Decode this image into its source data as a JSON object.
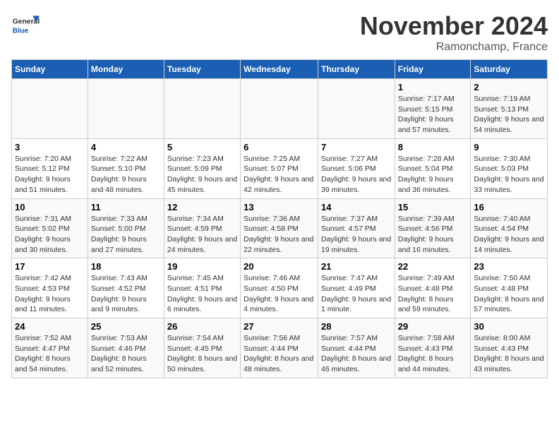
{
  "logo": {
    "text_general": "General",
    "text_blue": "Blue"
  },
  "header": {
    "month": "November 2024",
    "location": "Ramonchamp, France"
  },
  "days_of_week": [
    "Sunday",
    "Monday",
    "Tuesday",
    "Wednesday",
    "Thursday",
    "Friday",
    "Saturday"
  ],
  "weeks": [
    [
      {
        "day": "",
        "info": ""
      },
      {
        "day": "",
        "info": ""
      },
      {
        "day": "",
        "info": ""
      },
      {
        "day": "",
        "info": ""
      },
      {
        "day": "",
        "info": ""
      },
      {
        "day": "1",
        "info": "Sunrise: 7:17 AM\nSunset: 5:15 PM\nDaylight: 9 hours and 57 minutes."
      },
      {
        "day": "2",
        "info": "Sunrise: 7:19 AM\nSunset: 5:13 PM\nDaylight: 9 hours and 54 minutes."
      }
    ],
    [
      {
        "day": "3",
        "info": "Sunrise: 7:20 AM\nSunset: 5:12 PM\nDaylight: 9 hours and 51 minutes."
      },
      {
        "day": "4",
        "info": "Sunrise: 7:22 AM\nSunset: 5:10 PM\nDaylight: 9 hours and 48 minutes."
      },
      {
        "day": "5",
        "info": "Sunrise: 7:23 AM\nSunset: 5:09 PM\nDaylight: 9 hours and 45 minutes."
      },
      {
        "day": "6",
        "info": "Sunrise: 7:25 AM\nSunset: 5:07 PM\nDaylight: 9 hours and 42 minutes."
      },
      {
        "day": "7",
        "info": "Sunrise: 7:27 AM\nSunset: 5:06 PM\nDaylight: 9 hours and 39 minutes."
      },
      {
        "day": "8",
        "info": "Sunrise: 7:28 AM\nSunset: 5:04 PM\nDaylight: 9 hours and 36 minutes."
      },
      {
        "day": "9",
        "info": "Sunrise: 7:30 AM\nSunset: 5:03 PM\nDaylight: 9 hours and 33 minutes."
      }
    ],
    [
      {
        "day": "10",
        "info": "Sunrise: 7:31 AM\nSunset: 5:02 PM\nDaylight: 9 hours and 30 minutes."
      },
      {
        "day": "11",
        "info": "Sunrise: 7:33 AM\nSunset: 5:00 PM\nDaylight: 9 hours and 27 minutes."
      },
      {
        "day": "12",
        "info": "Sunrise: 7:34 AM\nSunset: 4:59 PM\nDaylight: 9 hours and 24 minutes."
      },
      {
        "day": "13",
        "info": "Sunrise: 7:36 AM\nSunset: 4:58 PM\nDaylight: 9 hours and 22 minutes."
      },
      {
        "day": "14",
        "info": "Sunrise: 7:37 AM\nSunset: 4:57 PM\nDaylight: 9 hours and 19 minutes."
      },
      {
        "day": "15",
        "info": "Sunrise: 7:39 AM\nSunset: 4:56 PM\nDaylight: 9 hours and 16 minutes."
      },
      {
        "day": "16",
        "info": "Sunrise: 7:40 AM\nSunset: 4:54 PM\nDaylight: 9 hours and 14 minutes."
      }
    ],
    [
      {
        "day": "17",
        "info": "Sunrise: 7:42 AM\nSunset: 4:53 PM\nDaylight: 9 hours and 11 minutes."
      },
      {
        "day": "18",
        "info": "Sunrise: 7:43 AM\nSunset: 4:52 PM\nDaylight: 9 hours and 9 minutes."
      },
      {
        "day": "19",
        "info": "Sunrise: 7:45 AM\nSunset: 4:51 PM\nDaylight: 9 hours and 6 minutes."
      },
      {
        "day": "20",
        "info": "Sunrise: 7:46 AM\nSunset: 4:50 PM\nDaylight: 9 hours and 4 minutes."
      },
      {
        "day": "21",
        "info": "Sunrise: 7:47 AM\nSunset: 4:49 PM\nDaylight: 9 hours and 1 minute."
      },
      {
        "day": "22",
        "info": "Sunrise: 7:49 AM\nSunset: 4:48 PM\nDaylight: 8 hours and 59 minutes."
      },
      {
        "day": "23",
        "info": "Sunrise: 7:50 AM\nSunset: 4:48 PM\nDaylight: 8 hours and 57 minutes."
      }
    ],
    [
      {
        "day": "24",
        "info": "Sunrise: 7:52 AM\nSunset: 4:47 PM\nDaylight: 8 hours and 54 minutes."
      },
      {
        "day": "25",
        "info": "Sunrise: 7:53 AM\nSunset: 4:46 PM\nDaylight: 8 hours and 52 minutes."
      },
      {
        "day": "26",
        "info": "Sunrise: 7:54 AM\nSunset: 4:45 PM\nDaylight: 8 hours and 50 minutes."
      },
      {
        "day": "27",
        "info": "Sunrise: 7:56 AM\nSunset: 4:44 PM\nDaylight: 8 hours and 48 minutes."
      },
      {
        "day": "28",
        "info": "Sunrise: 7:57 AM\nSunset: 4:44 PM\nDaylight: 8 hours and 46 minutes."
      },
      {
        "day": "29",
        "info": "Sunrise: 7:58 AM\nSunset: 4:43 PM\nDaylight: 8 hours and 44 minutes."
      },
      {
        "day": "30",
        "info": "Sunrise: 8:00 AM\nSunset: 4:43 PM\nDaylight: 8 hours and 43 minutes."
      }
    ]
  ]
}
